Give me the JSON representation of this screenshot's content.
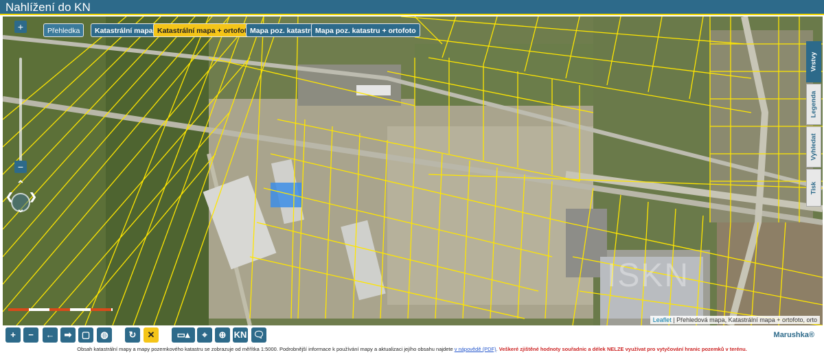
{
  "app": {
    "title": "Nahlížení do KN",
    "brand": "Marushka®"
  },
  "map_tabs": {
    "overview": "Přehledka",
    "cadastral_map": "Katastrální mapa",
    "cadastral_ortho": "Katastrální mapa + ortofoto",
    "land_map": "Mapa poz. katastru",
    "land_map_ortho": "Mapa poz. katastru + ortofoto"
  },
  "zoom": {
    "in": "+",
    "out": "−"
  },
  "side_tabs": {
    "layers": "Vrstvy",
    "legend": "Legenda",
    "search": "Vyhledat",
    "print": "Tisk"
  },
  "attribution": {
    "leaflet": "Leaflet",
    "text": "| Přehledová mapa, Katastrální mapa + ortofoto, orto"
  },
  "toolbar": {
    "zoom_in": "+",
    "zoom_out": "−",
    "back": "←",
    "forward": "➡",
    "extent": "▢",
    "globe": "◍",
    "refresh": "↻",
    "clear": "✕",
    "measure": "▭▴",
    "pin": "⌖",
    "locate": "⊕",
    "kn": "KN",
    "chat": "🗨"
  },
  "footer": {
    "text1": "Obsah katastrální mapy a mapy pozemkového katastru se zobrazuje od měřítka 1:5000. Podrobnější informace k používání mapy a aktualizaci jejího obsahu najdete",
    "link": "v nápovědě (PDF)",
    "text2": ".",
    "warning": "Veškeré zjištěné hodnoty souřadnic a délek NELZE využívat pro vytyčování hranic pozemků v terénu."
  },
  "colors": {
    "brand": "#2d6a8a",
    "accent": "#f5c518",
    "parcel_lines": "#ffe600",
    "highlight": "#3a8ae0"
  }
}
